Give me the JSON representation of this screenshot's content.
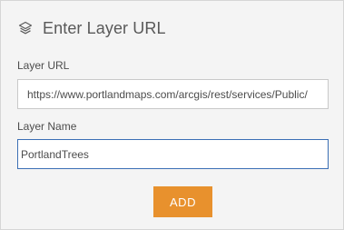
{
  "header": {
    "icon": "layers-icon",
    "title": "Enter Layer URL"
  },
  "form": {
    "url_label": "Layer URL",
    "url_value": "https://www.portlandmaps.com/arcgis/rest/services/Public/",
    "name_label": "Layer Name",
    "name_value": "PortlandTrees"
  },
  "actions": {
    "add_label": "ADD"
  },
  "colors": {
    "panel_bg": "#f4f4f4",
    "accent_button": "#e8912d",
    "focus_border": "#3b6fb5"
  }
}
